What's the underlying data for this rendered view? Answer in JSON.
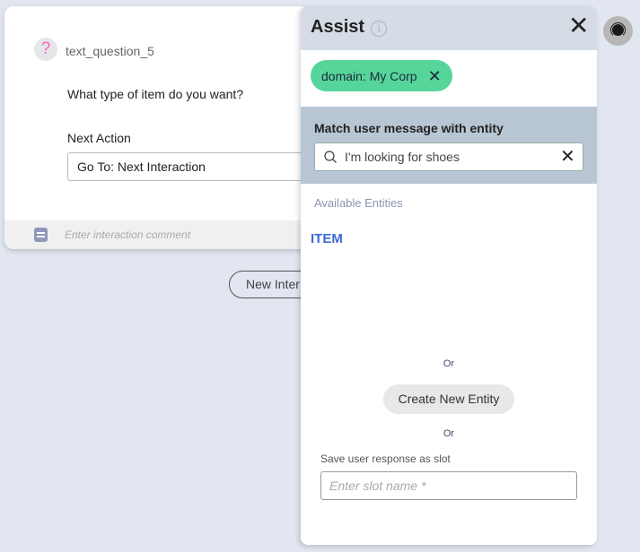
{
  "interaction_card": {
    "question_icon": "question-mark-icon",
    "name": "text_question_5",
    "question_text": "What type of item do you want?",
    "next_action_label": "Next Action",
    "next_action_value": "Go To:  Next Interaction",
    "comment_icon": "note-icon",
    "comment_placeholder": "Enter interaction comment"
  },
  "new_interaction_button": "New Inter",
  "assist_panel": {
    "title": "Assist",
    "info_icon": "info-icon",
    "close_icon": "close-icon",
    "domain_chip": {
      "label": "domain: My Corp",
      "remove_icon": "close-icon",
      "color": "#56d59a"
    },
    "match_section": {
      "title": "Match user message with entity",
      "search_value": "I'm looking for shoes",
      "search_icon": "search-icon",
      "clear_icon": "close-icon"
    },
    "available_entities_label": "Available Entities",
    "entities": [
      "ITEM"
    ],
    "or_1": "Or",
    "create_entity_button": "Create New Entity",
    "or_2": "Or",
    "slot_label": "Save user response as slot",
    "slot_placeholder": "Enter slot name *"
  },
  "agent_button_icon": "headset-icon"
}
